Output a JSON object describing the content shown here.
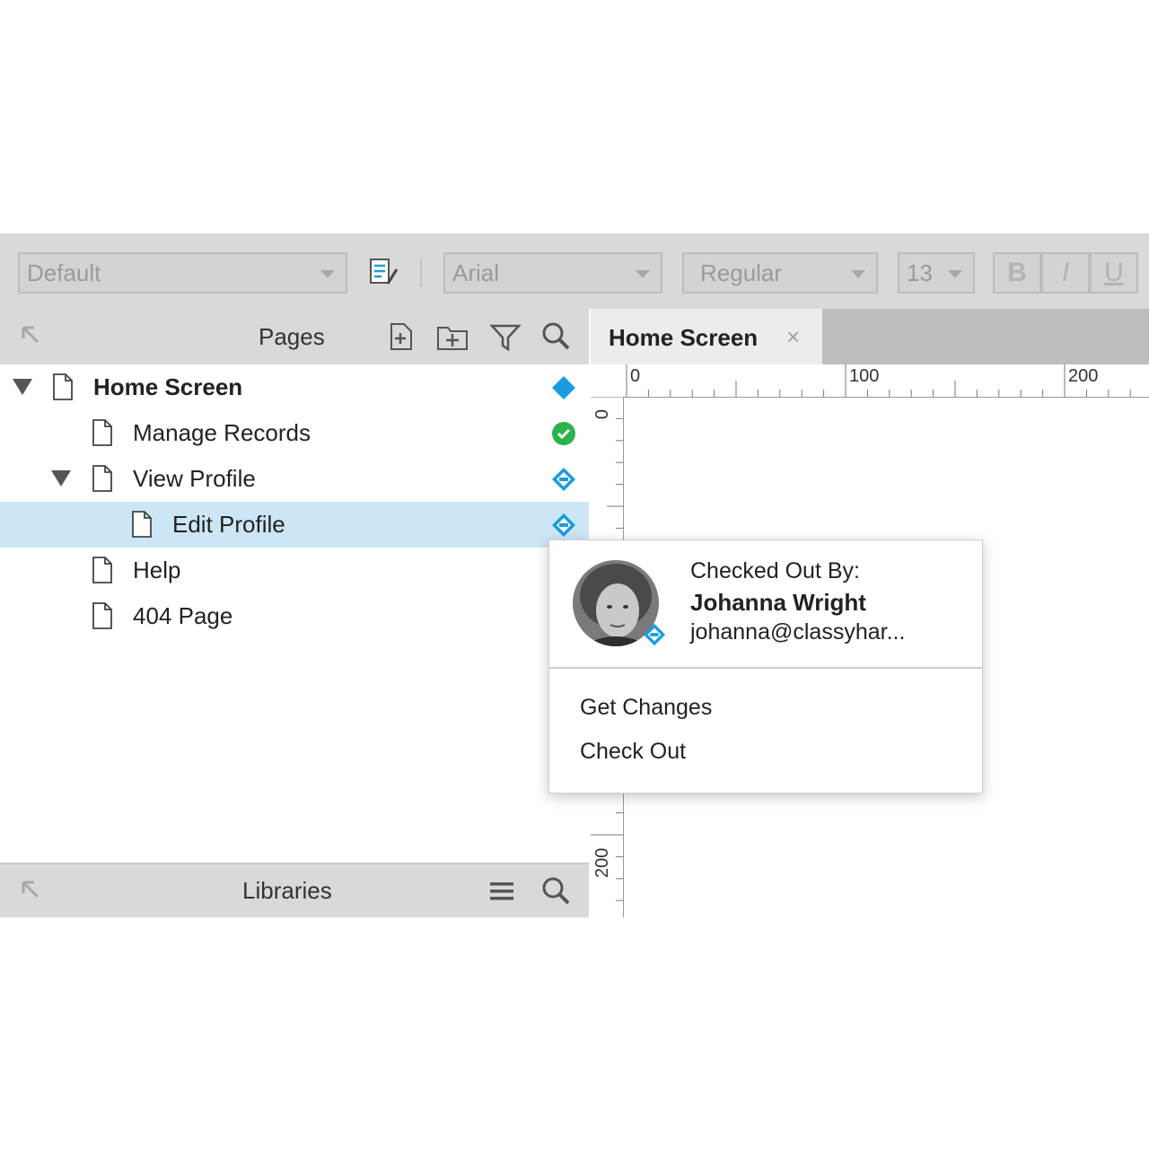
{
  "toolbar": {
    "style_value": "Default",
    "font_value": "Arial",
    "weight_value": "Regular",
    "size_value": "13",
    "bold_label": "B",
    "italic_label": "I",
    "underline_label": "U"
  },
  "pages_panel": {
    "title": "Pages",
    "items": [
      {
        "label": "Home Screen",
        "status": "checked-out-diamond"
      },
      {
        "label": "Manage Records",
        "status": "checked-in"
      },
      {
        "label": "View Profile",
        "status": "checked-out-by-other"
      },
      {
        "label": "Edit Profile",
        "status": "checked-out-by-other"
      },
      {
        "label": "Help"
      },
      {
        "label": "404 Page"
      }
    ]
  },
  "libraries_panel": {
    "title": "Libraries"
  },
  "canvas": {
    "tab_label": "Home Screen",
    "tab_close": "×",
    "ruler_h": [
      "0",
      "100",
      "200"
    ],
    "ruler_v": [
      "0",
      "200"
    ]
  },
  "popup": {
    "checked_out_label": "Checked Out By:",
    "user_name": "Johanna Wright",
    "user_email": "johanna@classyhar...",
    "menu": [
      "Get Changes",
      "Check Out"
    ]
  },
  "colors": {
    "accent_blue": "#1a9be0",
    "success_green": "#2bb24c",
    "selection": "#cce6f6",
    "toolbar_bg": "#d9d9d9"
  }
}
